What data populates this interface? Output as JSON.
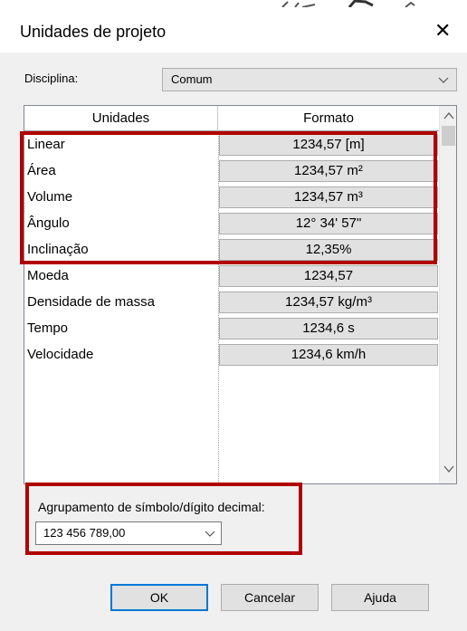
{
  "dialog": {
    "title": "Unidades de projeto"
  },
  "discipline": {
    "label": "Disciplina:",
    "value": "Comum"
  },
  "table": {
    "headers": {
      "units": "Unidades",
      "format": "Formato"
    },
    "rows": [
      {
        "unit": "Linear",
        "format": "1234,57 [m]"
      },
      {
        "unit": "Área",
        "format": "1234,57 m²"
      },
      {
        "unit": "Volume",
        "format": "1234,57 m³"
      },
      {
        "unit": "Ângulo",
        "format": "12° 34' 57\""
      },
      {
        "unit": "Inclinação",
        "format": "12,35%"
      },
      {
        "unit": "Moeda",
        "format": "1234,57"
      },
      {
        "unit": "Densidade de massa",
        "format": "1234,57 kg/m³"
      },
      {
        "unit": "Tempo",
        "format": "1234,6 s"
      },
      {
        "unit": "Velocidade",
        "format": "1234,6 km/h"
      }
    ]
  },
  "grouping": {
    "label": "Agrupamento de símbolo/dígito decimal:",
    "value": "123 456 789,00"
  },
  "buttons": {
    "ok": "OK",
    "cancel": "Cancelar",
    "help": "Ajuda"
  },
  "colors": {
    "highlight_border": "#b00000",
    "default_button_border": "#0078d7"
  }
}
